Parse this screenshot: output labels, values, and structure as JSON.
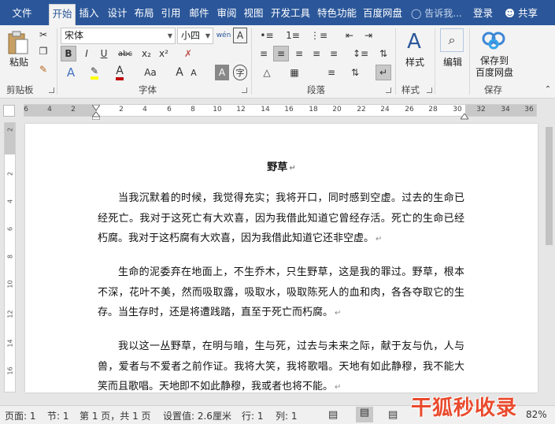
{
  "tabs": [
    {
      "label": "文件",
      "name": "tab-file"
    },
    {
      "label": "开始",
      "name": "tab-home"
    },
    {
      "label": "插入",
      "name": "tab-insert"
    },
    {
      "label": "设计",
      "name": "tab-design"
    },
    {
      "label": "布局",
      "name": "tab-layout"
    },
    {
      "label": "引用",
      "name": "tab-references"
    },
    {
      "label": "邮件",
      "name": "tab-mailings"
    },
    {
      "label": "审阅",
      "name": "tab-review"
    },
    {
      "label": "视图",
      "name": "tab-view"
    },
    {
      "label": "开发工具",
      "name": "tab-developer"
    },
    {
      "label": "特色功能",
      "name": "tab-features"
    },
    {
      "label": "百度网盘",
      "name": "tab-baidu"
    }
  ],
  "tell_me": "告诉我...",
  "login": "登录",
  "share": "共享",
  "ribbon": {
    "clipboard": {
      "paste": "粘贴",
      "group": "剪贴板"
    },
    "font": {
      "name": "宋体",
      "size": "小四",
      "wen": "wén",
      "group": "字体",
      "bold": "B",
      "italic": "I",
      "underline": "U",
      "strike": "abc",
      "sub": "x₂",
      "sup": "x²",
      "grow": "A",
      "shrink": "A",
      "case": "Aa"
    },
    "paragraph": {
      "group": "段落"
    },
    "styles": {
      "label": "样式",
      "group": "样式"
    },
    "editing": {
      "label": "编辑"
    },
    "save": {
      "label": "保存到\n百度网盘",
      "group": "保存"
    }
  },
  "ruler_ticks": [
    "6",
    "4",
    "2",
    "2",
    "4",
    "6",
    "8",
    "10",
    "12",
    "14",
    "16",
    "18",
    "20",
    "22",
    "24",
    "26",
    "28",
    "30",
    "32",
    "34",
    "36"
  ],
  "vruler_ticks": [
    "2",
    "2",
    "4",
    "6",
    "8",
    "10",
    "12",
    "14",
    "16"
  ],
  "document": {
    "title": "野草",
    "paragraphs": [
      "当我沉默着的时候，我觉得充实；我将开口，同时感到空虚。过去的生命已经死亡。我对于这死亡有大欢喜，因为我借此知道它曾经存活。死亡的生命已经朽腐。我对于这朽腐有大欢喜，因为我借此知道它还非空虚。",
      "生命的泥委弃在地面上，不生乔木，只生野草，这是我的罪过。野草，根本不深，花叶不美，然而吸取露，吸取水，吸取陈死人的血和肉，各各夺取它的生存。当生存时，还是将遭践踏，直至于死亡而朽腐。",
      "我以这一丛野草，在明与暗，生与死，过去与未来之际，献于友与仇，人与兽，爱者与不爱者之前作证。我将大笑，我将歌唱。天地有如此静穆，我不能大笑而且歌唱。天地即不如此静穆，我或者也将不能。"
    ]
  },
  "status": {
    "page": "页面: 1",
    "section": "节: 1",
    "pages": "第 1 页，共 1 页",
    "position": "设置值: 2.6厘米",
    "line": "行: 1",
    "col": "列: 1",
    "zoom": "82%"
  },
  "watermark": "干狐秒收录"
}
